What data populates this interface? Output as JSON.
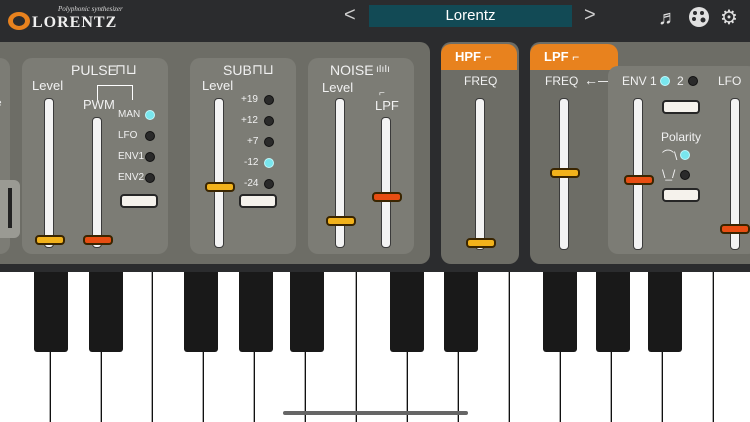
{
  "app": {
    "logo_tagline": "Polyphonic synthesizer",
    "logo_name": "LORENTZ"
  },
  "header": {
    "prev": "<",
    "preset_name": "Lorentz",
    "next": ">"
  },
  "pulse": {
    "title": "PULSE",
    "level": "Level",
    "pwm": "PWM",
    "man": "MAN",
    "lfo": "LFO",
    "env1": "ENV1",
    "env2": "ENV2"
  },
  "sub": {
    "title": "SUB",
    "level": "Level",
    "options": [
      "+19",
      "+12",
      "+7",
      "-12",
      "-24"
    ]
  },
  "noise": {
    "title": "NOISE",
    "level": "Level",
    "lpf": "LPF"
  },
  "hpf": {
    "tab": "HPF",
    "freq": "FREQ"
  },
  "lpf": {
    "tab": "LPF",
    "freq": "FREQ",
    "env1": "ENV 1",
    "env2": "2",
    "lfo": "LFO",
    "polarity": "Polarity"
  },
  "colors": {
    "accent": "#e8821e",
    "preset_bg": "#124a55",
    "led_on": "#78e6ee"
  }
}
